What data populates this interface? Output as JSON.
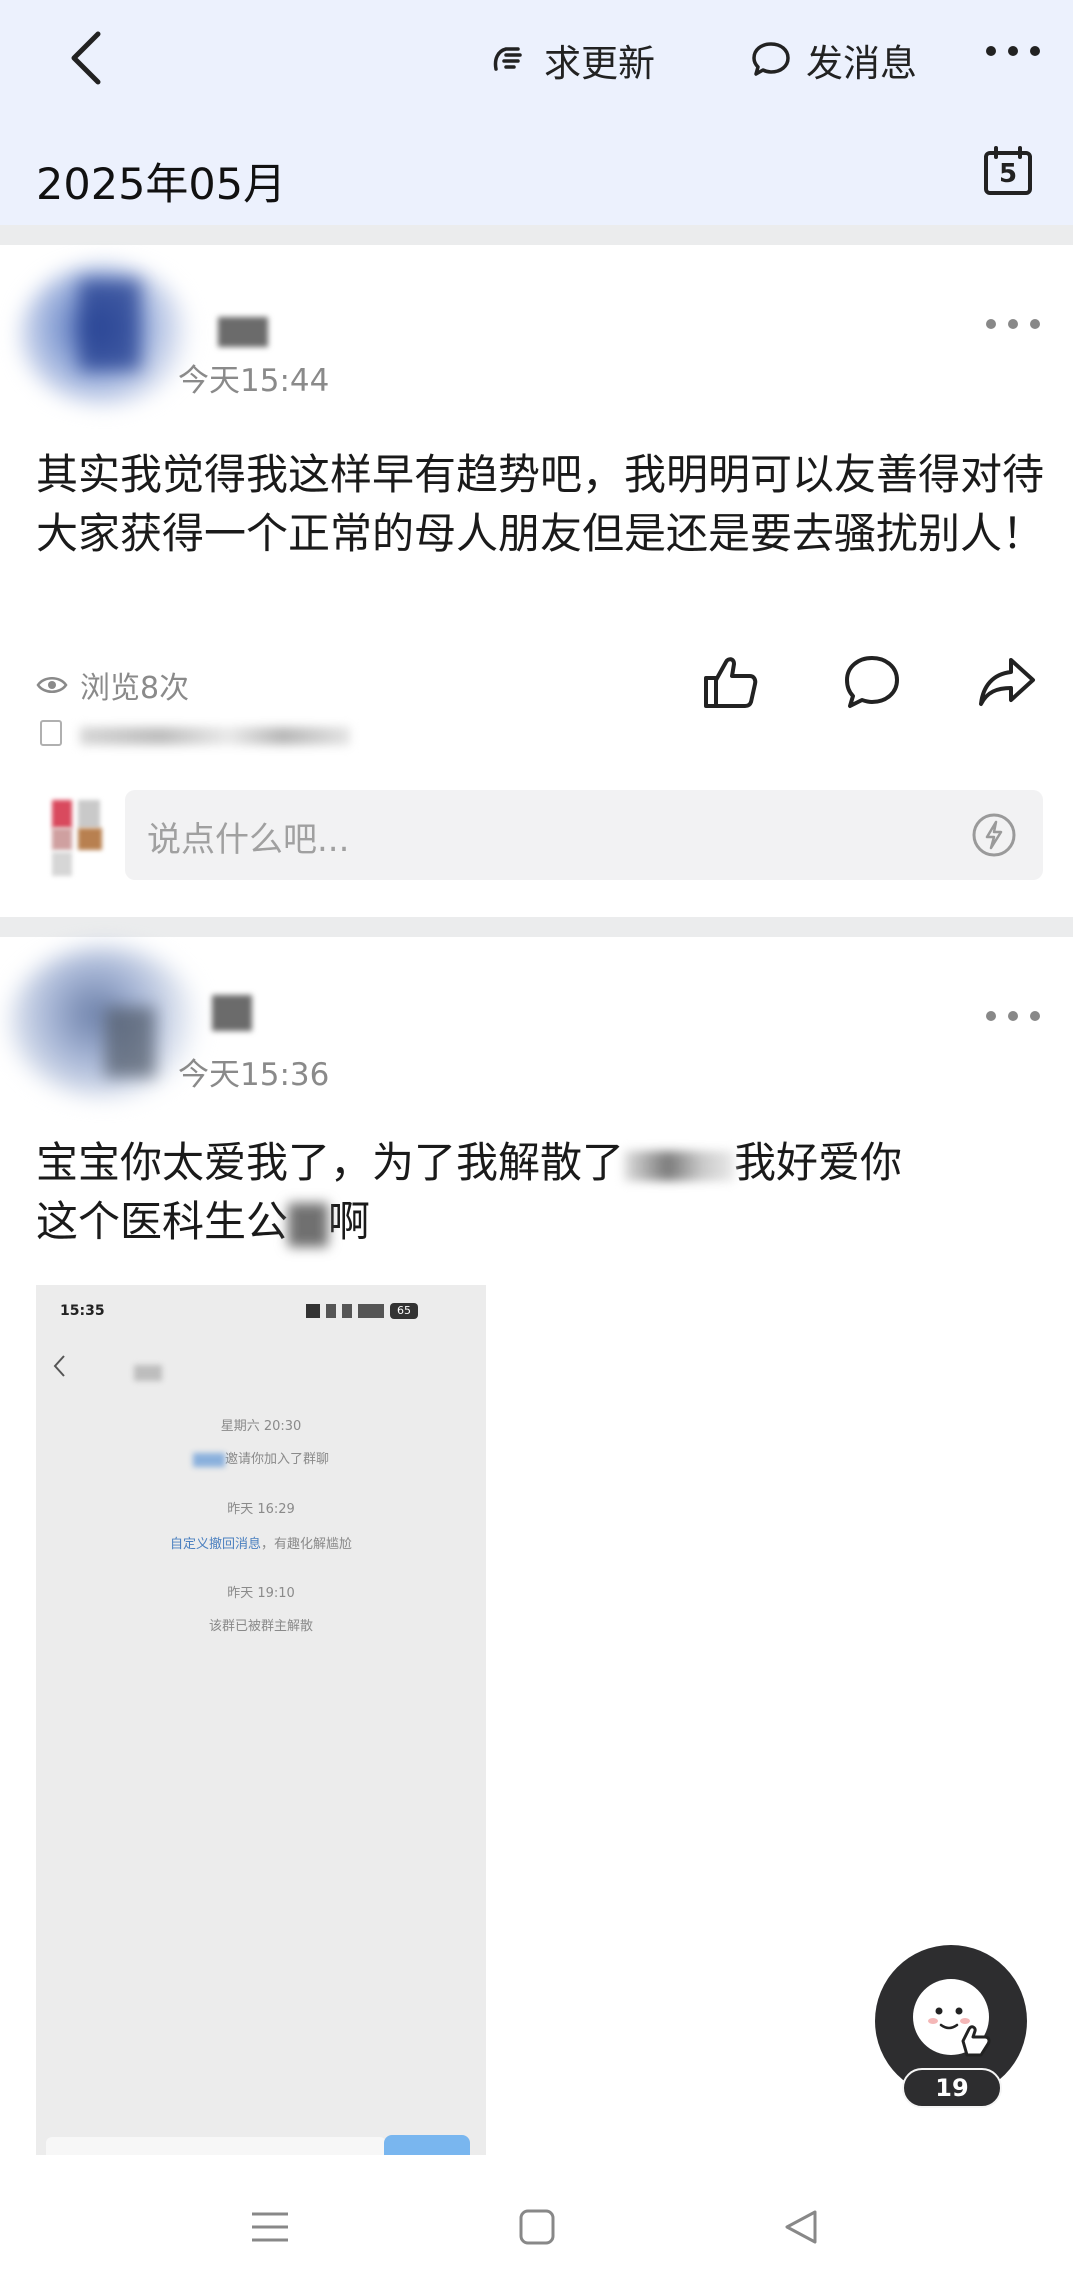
{
  "header": {
    "request_update_label": "求更新",
    "message_label": "发消息",
    "date_label": "2025年05月",
    "calendar_day": "5"
  },
  "posts": [
    {
      "time": "今天15:44",
      "text": "其实我觉得我这样早有趋势吧，我明明可以友善得对待大家获得一个正常的母人朋友但是还是要去骚扰别人！",
      "views": "浏览8次"
    },
    {
      "time": "今天15:36",
      "text_line1": "宝宝你太爱我了，为了我解散了",
      "text_line1_tail": "我好爱你",
      "text_line2": "这个医科生公",
      "text_line2_tail": "啊"
    }
  ],
  "comment": {
    "placeholder": "说点什么吧..."
  },
  "embedded_screenshot": {
    "status_time": "15:35",
    "battery": "65",
    "ts1": "星期六 20:30",
    "msg1": "邀请你加入了群聊",
    "ts2": "昨天 16:29",
    "msg2_link": "自定义撤回消息",
    "msg2_rest": "，有趣化解尴尬",
    "ts3": "昨天 19:10",
    "msg3": "该群已被群主解散"
  },
  "fab": {
    "badge": "19"
  },
  "colors": {
    "header_bg": "#ecf1fd",
    "separator": "#ebeced",
    "fab": "#2d2d2f",
    "link": "#4a7fbf"
  }
}
